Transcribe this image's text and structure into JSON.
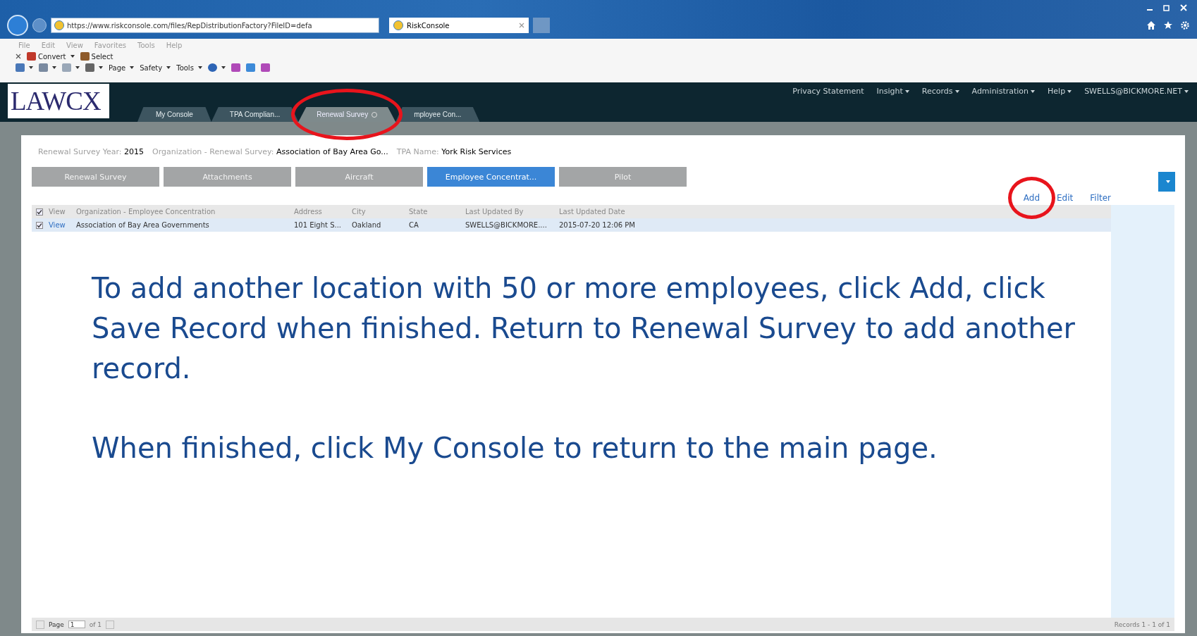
{
  "browser": {
    "url": "https://www.riskconsole.com/files/RepDistributionFactory?FileID=defa",
    "tab_title": "RiskConsole",
    "menu": [
      "File",
      "Edit",
      "View",
      "Favorites",
      "Tools",
      "Help"
    ],
    "command_bar_1": [
      {
        "label": "Convert",
        "dropdown": true
      },
      {
        "label": "Select",
        "dropdown": false
      }
    ],
    "command_bar_2": [
      {
        "label": "Page",
        "dropdown": true
      },
      {
        "label": "Safety",
        "dropdown": true
      },
      {
        "label": "Tools",
        "dropdown": true
      }
    ]
  },
  "app": {
    "logo": "LAWCX",
    "top_nav": [
      {
        "label": "Privacy Statement",
        "dropdown": false
      },
      {
        "label": "Insight",
        "dropdown": true
      },
      {
        "label": "Records",
        "dropdown": true
      },
      {
        "label": "Administration",
        "dropdown": true
      },
      {
        "label": "Help",
        "dropdown": true
      },
      {
        "label": "SWELLS@BICKMORE.NET",
        "dropdown": true
      }
    ],
    "tabs": [
      {
        "label": "My Console",
        "selected": false,
        "closable": false,
        "circled": false
      },
      {
        "label": "TPA Complian...",
        "selected": false,
        "closable": false,
        "circled": false
      },
      {
        "label": "Renewal Survey",
        "selected": true,
        "closable": true,
        "circled": true
      },
      {
        "label": "mployee Con...",
        "selected": false,
        "closable": false,
        "circled": false
      }
    ]
  },
  "record_header": [
    {
      "label": "Renewal Survey Year:",
      "value": "2015"
    },
    {
      "label": "Organization - Renewal Survey:",
      "value": "Association of Bay Area Go..."
    },
    {
      "label": "TPA Name:",
      "value": "York Risk Services"
    }
  ],
  "section_tabs": [
    {
      "label": "Renewal Survey",
      "selected": false
    },
    {
      "label": "Attachments",
      "selected": false
    },
    {
      "label": "Aircraft",
      "selected": false
    },
    {
      "label": "Employee Concentrat...",
      "selected": true
    },
    {
      "label": "Pilot",
      "selected": false
    }
  ],
  "actions": [
    {
      "label": "Add",
      "circled": true
    },
    {
      "label": "Edit",
      "circled": false
    },
    {
      "label": "Filter",
      "circled": false
    }
  ],
  "table": {
    "header_checked": true,
    "columns": [
      "View",
      "Organization - Employee Concentration",
      "Address",
      "City",
      "State",
      "Last Updated By",
      "Last Updated Date"
    ],
    "rows": [
      {
        "checked": true,
        "selected": true,
        "cells": [
          "View",
          "Association of Bay Area Governments",
          "101 Eight S...",
          "Oakland",
          "CA",
          "SWELLS@BICKMORE....",
          "2015-07-20 12:06 PM"
        ]
      }
    ]
  },
  "instructions": [
    "To add another location with 50 or more employees, click Add, click Save Record when finished. Return to Renewal Survey to add another record.",
    "When finished, click My Console to return to the main page."
  ],
  "footer": {
    "page_label": "Page",
    "page_value": "1",
    "page_of": "of 1",
    "records": "Records 1 - 1 of 1"
  }
}
